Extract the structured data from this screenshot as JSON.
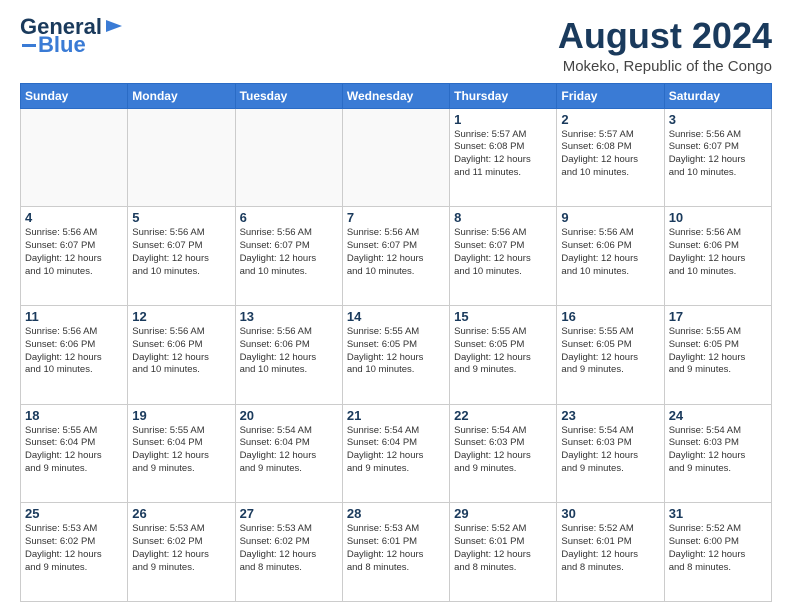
{
  "logo": {
    "text1": "General",
    "text2": "Blue"
  },
  "title": "August 2024",
  "subtitle": "Mokeko, Republic of the Congo",
  "headers": [
    "Sunday",
    "Monday",
    "Tuesday",
    "Wednesday",
    "Thursday",
    "Friday",
    "Saturday"
  ],
  "weeks": [
    [
      {
        "day": "",
        "info": "",
        "empty": true
      },
      {
        "day": "",
        "info": "",
        "empty": true
      },
      {
        "day": "",
        "info": "",
        "empty": true
      },
      {
        "day": "",
        "info": "",
        "empty": true
      },
      {
        "day": "1",
        "info": "Sunrise: 5:57 AM\nSunset: 6:08 PM\nDaylight: 12 hours\nand 11 minutes."
      },
      {
        "day": "2",
        "info": "Sunrise: 5:57 AM\nSunset: 6:08 PM\nDaylight: 12 hours\nand 10 minutes."
      },
      {
        "day": "3",
        "info": "Sunrise: 5:56 AM\nSunset: 6:07 PM\nDaylight: 12 hours\nand 10 minutes."
      }
    ],
    [
      {
        "day": "4",
        "info": "Sunrise: 5:56 AM\nSunset: 6:07 PM\nDaylight: 12 hours\nand 10 minutes."
      },
      {
        "day": "5",
        "info": "Sunrise: 5:56 AM\nSunset: 6:07 PM\nDaylight: 12 hours\nand 10 minutes."
      },
      {
        "day": "6",
        "info": "Sunrise: 5:56 AM\nSunset: 6:07 PM\nDaylight: 12 hours\nand 10 minutes."
      },
      {
        "day": "7",
        "info": "Sunrise: 5:56 AM\nSunset: 6:07 PM\nDaylight: 12 hours\nand 10 minutes."
      },
      {
        "day": "8",
        "info": "Sunrise: 5:56 AM\nSunset: 6:07 PM\nDaylight: 12 hours\nand 10 minutes."
      },
      {
        "day": "9",
        "info": "Sunrise: 5:56 AM\nSunset: 6:06 PM\nDaylight: 12 hours\nand 10 minutes."
      },
      {
        "day": "10",
        "info": "Sunrise: 5:56 AM\nSunset: 6:06 PM\nDaylight: 12 hours\nand 10 minutes."
      }
    ],
    [
      {
        "day": "11",
        "info": "Sunrise: 5:56 AM\nSunset: 6:06 PM\nDaylight: 12 hours\nand 10 minutes."
      },
      {
        "day": "12",
        "info": "Sunrise: 5:56 AM\nSunset: 6:06 PM\nDaylight: 12 hours\nand 10 minutes."
      },
      {
        "day": "13",
        "info": "Sunrise: 5:56 AM\nSunset: 6:06 PM\nDaylight: 12 hours\nand 10 minutes."
      },
      {
        "day": "14",
        "info": "Sunrise: 5:55 AM\nSunset: 6:05 PM\nDaylight: 12 hours\nand 10 minutes."
      },
      {
        "day": "15",
        "info": "Sunrise: 5:55 AM\nSunset: 6:05 PM\nDaylight: 12 hours\nand 9 minutes."
      },
      {
        "day": "16",
        "info": "Sunrise: 5:55 AM\nSunset: 6:05 PM\nDaylight: 12 hours\nand 9 minutes."
      },
      {
        "day": "17",
        "info": "Sunrise: 5:55 AM\nSunset: 6:05 PM\nDaylight: 12 hours\nand 9 minutes."
      }
    ],
    [
      {
        "day": "18",
        "info": "Sunrise: 5:55 AM\nSunset: 6:04 PM\nDaylight: 12 hours\nand 9 minutes."
      },
      {
        "day": "19",
        "info": "Sunrise: 5:55 AM\nSunset: 6:04 PM\nDaylight: 12 hours\nand 9 minutes."
      },
      {
        "day": "20",
        "info": "Sunrise: 5:54 AM\nSunset: 6:04 PM\nDaylight: 12 hours\nand 9 minutes."
      },
      {
        "day": "21",
        "info": "Sunrise: 5:54 AM\nSunset: 6:04 PM\nDaylight: 12 hours\nand 9 minutes."
      },
      {
        "day": "22",
        "info": "Sunrise: 5:54 AM\nSunset: 6:03 PM\nDaylight: 12 hours\nand 9 minutes."
      },
      {
        "day": "23",
        "info": "Sunrise: 5:54 AM\nSunset: 6:03 PM\nDaylight: 12 hours\nand 9 minutes."
      },
      {
        "day": "24",
        "info": "Sunrise: 5:54 AM\nSunset: 6:03 PM\nDaylight: 12 hours\nand 9 minutes."
      }
    ],
    [
      {
        "day": "25",
        "info": "Sunrise: 5:53 AM\nSunset: 6:02 PM\nDaylight: 12 hours\nand 9 minutes."
      },
      {
        "day": "26",
        "info": "Sunrise: 5:53 AM\nSunset: 6:02 PM\nDaylight: 12 hours\nand 9 minutes."
      },
      {
        "day": "27",
        "info": "Sunrise: 5:53 AM\nSunset: 6:02 PM\nDaylight: 12 hours\nand 8 minutes."
      },
      {
        "day": "28",
        "info": "Sunrise: 5:53 AM\nSunset: 6:01 PM\nDaylight: 12 hours\nand 8 minutes."
      },
      {
        "day": "29",
        "info": "Sunrise: 5:52 AM\nSunset: 6:01 PM\nDaylight: 12 hours\nand 8 minutes."
      },
      {
        "day": "30",
        "info": "Sunrise: 5:52 AM\nSunset: 6:01 PM\nDaylight: 12 hours\nand 8 minutes."
      },
      {
        "day": "31",
        "info": "Sunrise: 5:52 AM\nSunset: 6:00 PM\nDaylight: 12 hours\nand 8 minutes."
      }
    ]
  ]
}
